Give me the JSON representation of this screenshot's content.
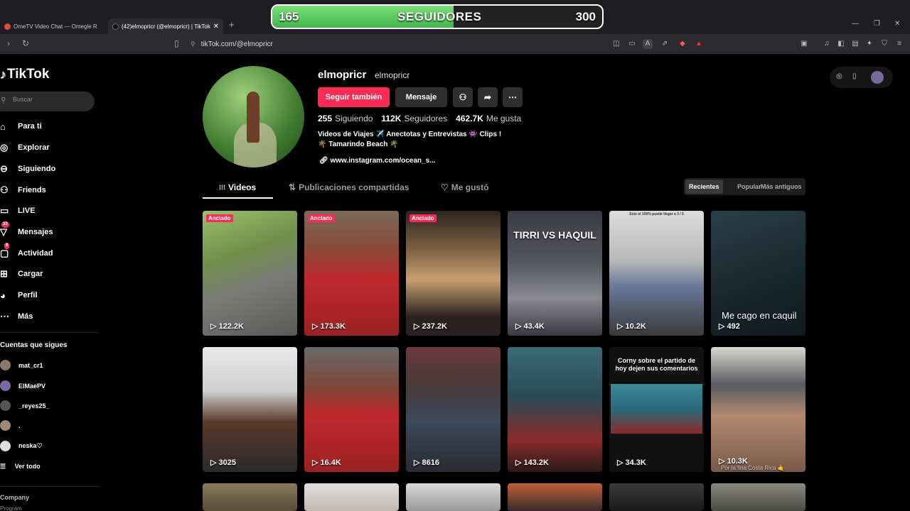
{
  "browser": {
    "tabs": [
      {
        "title": "OmeTV Video Chat — Omegle R"
      },
      {
        "title": "(42)elmopricr (@elmopricr) | TikTok"
      }
    ],
    "url": "tikTok.com/@elmopricr"
  },
  "overlay": {
    "current": "165",
    "label": "SEGUIDORES",
    "goal": "300",
    "progress": 0.55
  },
  "sidebar": {
    "brand": "TikTok",
    "search_placeholder": "Buscar",
    "nav": [
      {
        "label": "Para ti",
        "icon": "home-icon"
      },
      {
        "label": "Explorar",
        "icon": "compass-icon"
      },
      {
        "label": "Siguiendo",
        "icon": "following-icon"
      },
      {
        "label": "Friends",
        "icon": "friends-icon"
      },
      {
        "label": "LIVE",
        "icon": "live-icon"
      },
      {
        "label": "Mensajes",
        "icon": "messages-icon",
        "badge": "33"
      },
      {
        "label": "Actividad",
        "icon": "activity-icon",
        "badge": "9"
      },
      {
        "label": "Cargar",
        "icon": "upload-icon"
      },
      {
        "label": "Perfil",
        "icon": "profile-icon"
      },
      {
        "label": "Más",
        "icon": "more-icon"
      }
    ],
    "following_title": "Cuentas que sigues",
    "following": [
      {
        "name": "mat_cr1"
      },
      {
        "name": "ElMaePV"
      },
      {
        "name": "_reyes25_"
      },
      {
        "name": "."
      },
      {
        "name": "neska♡"
      }
    ],
    "see_all": "Ver todo",
    "company": "Company",
    "program": "Program"
  },
  "profile": {
    "username": "elmopricr",
    "handle": "elmopricr",
    "follow_label": "Seguir también",
    "message_label": "Mensaje",
    "stats": [
      {
        "value": "255",
        "label": "Siguiendo"
      },
      {
        "value": "112K",
        "label": "Seguidores"
      },
      {
        "value": "462.7K",
        "label": "Me gusta"
      }
    ],
    "bio_line1": "Videos de Viajes ✈️ Anectotas y Entrevistas 👾 Clips !",
    "bio_line2": "🌴 Tamarindo Beach 🌴",
    "link": "www.instagram.com/ocean_s..."
  },
  "tabs": {
    "videos": "Videos",
    "reposts": "Publicaciones compartidas",
    "liked": "Me gustó"
  },
  "sort": {
    "recent": "Recientes",
    "popular": "Popular",
    "oldest": "Más antiguos"
  },
  "pinned_label": "Anclado",
  "videos": [
    {
      "views": "122.2K",
      "pinned": true
    },
    {
      "views": "173.3K",
      "pinned": true
    },
    {
      "views": "237.2K",
      "pinned": true
    },
    {
      "views": "43.4K",
      "caption": "TIRRI VS HAQUIL"
    },
    {
      "views": "10.2K",
      "caption": "Solo el 100% puede llegar a 3 / 5"
    },
    {
      "views": "492",
      "caption": "Me cago en caquil"
    },
    {
      "views": "3025"
    },
    {
      "views": "16.4K"
    },
    {
      "views": "8616"
    },
    {
      "views": "143.2K"
    },
    {
      "views": "34.3K",
      "caption": "Corny sobre el partido de hoy  dejen sus comentarios"
    },
    {
      "views": "10.3K",
      "caption": "Por la fina Costa Rica 🤙"
    }
  ],
  "colors": {
    "accent": "#fe2c55",
    "overlay_fill": "#3fb54a"
  }
}
